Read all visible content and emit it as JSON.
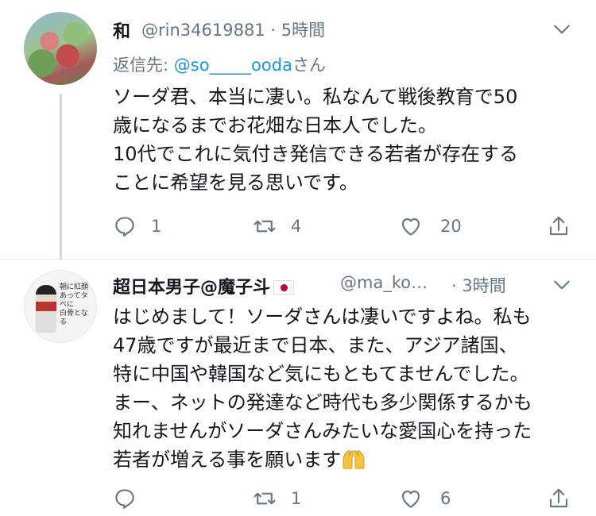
{
  "tweet1": {
    "name": "和",
    "handle": "@rin34619881",
    "sep": "·",
    "time": "5時間",
    "reply_prefix": "返信先: ",
    "reply_mention": "@so_____ooda",
    "reply_suffix": "さん",
    "lines": [
      "ソーダ君、本当に凄い。私なんて戦後教育で50",
      "歳になるまでお花畑な日本人でした。",
      "10代でこれに気付き発信できる若者が存在する",
      "ことに希望を見る思いです。"
    ],
    "reply_count": "1",
    "retweet_count": "4",
    "like_count": "20"
  },
  "tweet2": {
    "name": "超日本男子@魔子斗",
    "handle": "@ma_ko…",
    "sep": "·",
    "time": "3時間",
    "avatar_text": [
      "朝に紅顔",
      "あってタベに",
      "白骨となる"
    ],
    "lines": [
      "はじめまして！ソーダさんは凄いですよね。私も",
      "47歳ですが最近まで日本、また、アジア諸国、",
      "特に中国や韓国など気にもともてませんでした。",
      "まー、ネットの発達など時代も多少関係するかも",
      "知れませんがソーダさんみたいな愛国心を持った",
      "若者が増える事を願います"
    ],
    "reply_count": "",
    "retweet_count": "1",
    "like_count": "6"
  },
  "icons": [
    "chevron-down-icon",
    "reply-icon",
    "retweet-icon",
    "like-icon",
    "share-icon",
    "japan-flag-icon",
    "raised-hands-icon"
  ],
  "colors": {
    "text": "#14171a",
    "muted": "#657786",
    "link": "#1b95e0",
    "divider": "#e6ecf0"
  }
}
